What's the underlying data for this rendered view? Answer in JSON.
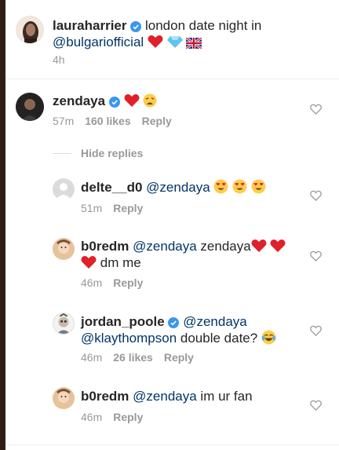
{
  "post": {
    "username": "lauraharrier",
    "caption": "london date night in",
    "mention": "@bulgariofficial",
    "time": "4h"
  },
  "comments": [
    {
      "username": "zendaya",
      "time": "57m",
      "likes": "160 likes",
      "reply": "Reply"
    },
    {
      "username": "delte__d0",
      "mention": "@zendaya",
      "time": "51m",
      "reply": "Reply"
    },
    {
      "username": "b0redm",
      "mention": "@zendaya",
      "text": "zendaya",
      "text2": "dm me",
      "time": "46m",
      "reply": "Reply"
    },
    {
      "username": "jordan_poole",
      "mention": "@zendaya",
      "mention2": "@klaythompson",
      "text": "double date?",
      "time": "46m",
      "likes": "26 likes",
      "reply": "Reply"
    },
    {
      "username": "b0redm",
      "mention": "@zendaya",
      "text": "im ur fan",
      "time": "46m",
      "reply": "Reply"
    }
  ],
  "hide_replies": "Hide replies",
  "colors": {
    "mention": "#003569",
    "meta": "#999999",
    "verified": "#3897f0",
    "heart_red": "#e0202b"
  },
  "icons": [
    "verified-badge-icon",
    "heart-outline-icon",
    "red-heart-emoji",
    "gem-emoji",
    "uk-flag-emoji",
    "weary-face-emoji",
    "heart-eyes-emoji",
    "laughing-tears-emoji"
  ]
}
